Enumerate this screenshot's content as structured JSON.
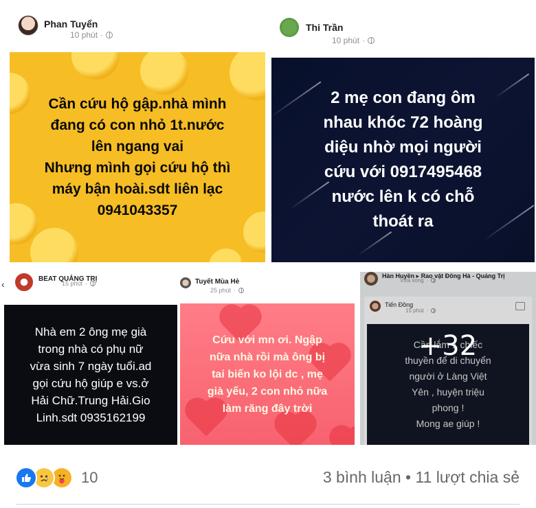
{
  "posts": [
    {
      "author": "Phan Tuyển",
      "time": "10 phút",
      "text": "Cần cứu hộ gập.nhà mình\nđang có con nhỏ 1t.nước\nlên ngang vai\nNhưng mình gọi cứu hộ thì\nmáy bận hoài.sdt liên lạc\n0941043357",
      "background": "#f6bd24"
    },
    {
      "author": "Thi Trần",
      "time": "10 phút",
      "text": "2 mẹ con đang ôm\nnhau khóc 72 hoàng\ndiệu nhờ mọi người\ncứu  với 0917495468\nnước lên k có chỗ\nthoát ra",
      "background": "#0d1433"
    },
    {
      "author": "BEAT QUẢNG TRỊ",
      "time": "15 phút",
      "text": "Nhà em 2 ông mẹ già\ntrong nhà có phụ nữ\nvừa sinh 7 ngày tuổi.ad\ngọi cứu hộ giúp e vs.ở\nHải Chữ.Trung Hải.Gio\nLinh.sdt 0935162199",
      "background": "#0b0c12"
    },
    {
      "author": "Tuyết Mùa Hè",
      "time": "25 phút",
      "text": "Cứu với mn ơi. Ngập\nnữa nhà rồi mà ông bị\ntai biến ko lội dc , mẹ\ngià yếu, 2 con nhỏ nữa\nlàm răng đây trời",
      "background": "#f7626f"
    },
    {
      "author": "Hàn Huyền",
      "group_arrow": "▸",
      "group": "Rao vặt Đông Hà - Quảng Trị",
      "time": "Vừa xong",
      "shared_author": "Tiến Đồng",
      "shared_time": "15 phút",
      "text": "Cần lắm 1 chiếc\nthuyền để di chuyển\nngười ở Làng Việt\nYên , huyện triệu\nphong !\nMong ae giúp !",
      "more_count": "+32",
      "background": "#121826"
    }
  ],
  "footer": {
    "reaction_icons": [
      "like-icon",
      "sad-icon",
      "care-icon"
    ],
    "reaction_count": "10",
    "comments": "3 bình luận",
    "separator": "•",
    "shares": "11 lượt chia sẻ"
  },
  "colors": {
    "facebook_blue": "#1877f2",
    "meta_gray": "#8a8d91"
  }
}
